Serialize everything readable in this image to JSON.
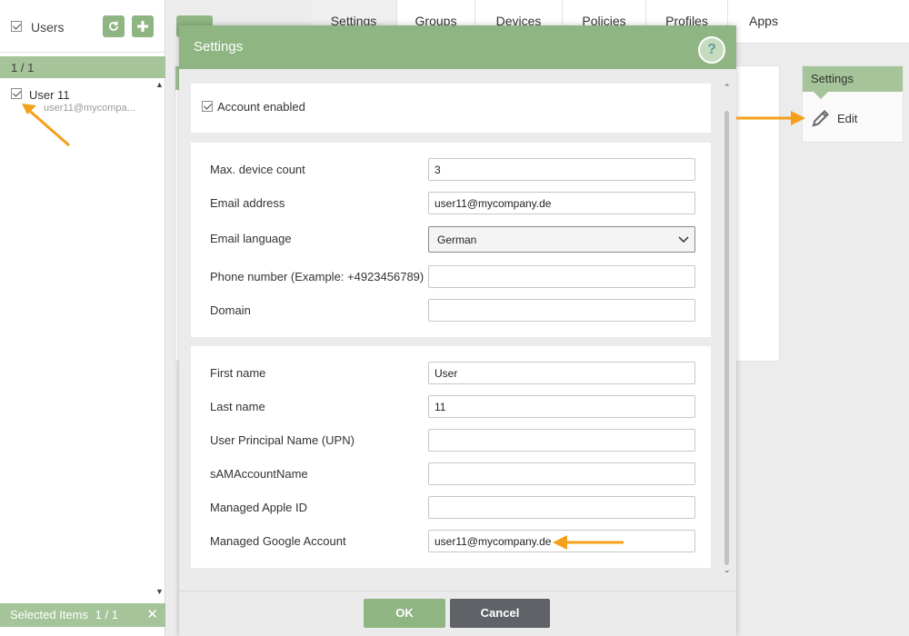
{
  "sidebar": {
    "title": "Users",
    "counter": "1 / 1",
    "user": {
      "name": "User 11",
      "email": "user11@mycompa..."
    },
    "footer": {
      "label": "Selected Items",
      "count": "1 / 1"
    },
    "refresh_icon": "refresh-icon",
    "add_icon": "plus-icon"
  },
  "tabs": [
    {
      "label": "Settings",
      "active": true
    },
    {
      "label": "Groups"
    },
    {
      "label": "Devices"
    },
    {
      "label": "Policies"
    },
    {
      "label": "Profiles"
    },
    {
      "label": "Apps"
    }
  ],
  "right_panel": {
    "title": "Settings",
    "edit_label": "Edit",
    "edit_icon": "pencil-icon"
  },
  "modal": {
    "title": "Settings",
    "help_label": "?",
    "account_enabled": {
      "label": "Account enabled",
      "checked": true
    },
    "fields": {
      "max_device_count": {
        "label": "Max. device count",
        "value": "3"
      },
      "email_address": {
        "label": "Email address",
        "value": "user11@mycompany.de"
      },
      "email_language": {
        "label": "Email language",
        "value": "German"
      },
      "phone_number": {
        "label": "Phone number (Example: +4923456789)",
        "value": ""
      },
      "domain": {
        "label": "Domain",
        "value": ""
      },
      "first_name": {
        "label": "First name",
        "value": "User"
      },
      "last_name": {
        "label": "Last name",
        "value": "11"
      },
      "upn": {
        "label": "User Principal Name (UPN)",
        "value": ""
      },
      "sam_account_name": {
        "label": "sAMAccountName",
        "value": ""
      },
      "managed_apple_id": {
        "label": "Managed Apple ID",
        "value": ""
      },
      "managed_google_account": {
        "label": "Managed Google Account",
        "value": "user11@mycompany.de"
      }
    },
    "ok_label": "OK",
    "cancel_label": "Cancel"
  },
  "colors": {
    "accent": "#8fb583",
    "accent_light": "#a5c499",
    "cancel": "#5f6368",
    "annotation_arrow": "#f5a01a"
  }
}
